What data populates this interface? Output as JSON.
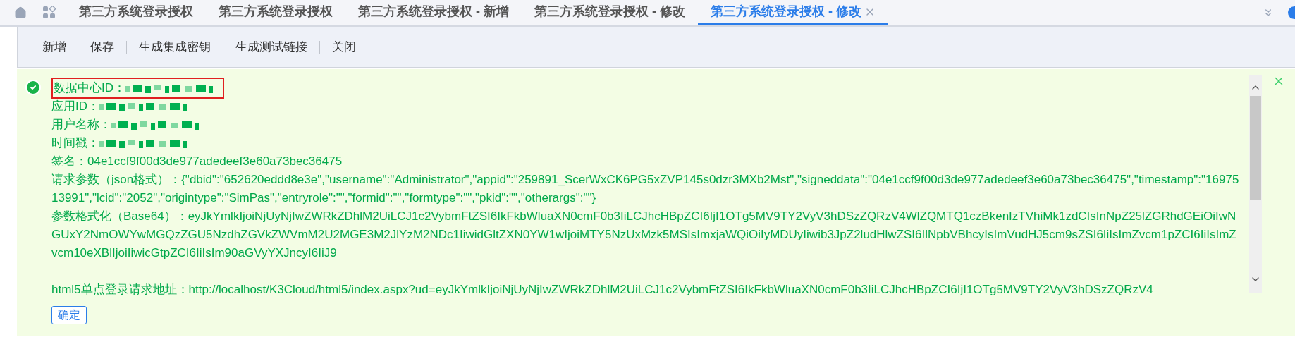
{
  "tabs": [
    {
      "label": "第三方系统登录授权",
      "selected": false,
      "closable": false
    },
    {
      "label": "第三方系统登录授权",
      "selected": false,
      "closable": false
    },
    {
      "label": "第三方系统登录授权 - 新增",
      "selected": false,
      "closable": false
    },
    {
      "label": "第三方系统登录授权 - 修改",
      "selected": false,
      "closable": false
    },
    {
      "label": "第三方系统登录授权 - 修改",
      "selected": true,
      "closable": true
    }
  ],
  "toolbar": [
    "新增",
    "保存",
    "生成集成密钥",
    "生成测试链接",
    "关闭"
  ],
  "message": {
    "lines": [
      {
        "kind": "masked",
        "label": "数据中心ID：",
        "highlighted": true
      },
      {
        "kind": "masked",
        "label": "应用ID：",
        "highlighted": false
      },
      {
        "kind": "masked",
        "label": "用户名称：",
        "highlighted": false
      },
      {
        "kind": "masked",
        "label": "时间戳：",
        "highlighted": false
      },
      {
        "kind": "text",
        "text": "签名：04e1ccf9f00d3de977adedeef3e60a73bec36475"
      },
      {
        "kind": "text",
        "text": "请求参数（json格式）：{\"dbid\":\"652620eddd8e3e\",\"username\":\"Administrator\",\"appid\":\"259891_ScerWxCK6PG5xZVP145s0dzr3MXb2Mst\",\"signeddata\":\"04e1ccf9f00d3de977adedeef3e60a73bec36475\",\"timestamp\":\"1697513991\",\"lcid\":\"2052\",\"origintype\":\"SimPas\",\"entryrole\":\"\",\"formid\":\"\",\"formtype\":\"\",\"pkid\":\"\",\"otherargs\":\"\"}"
      },
      {
        "kind": "text",
        "text": "参数格式化（Base64）：eyJkYmlkIjoiNjUyNjIwZWRkZDhlM2UiLCJ1c2VybmFtZSI6IkFkbWluaXN0cmF0b3IiLCJhcHBpZCI6IjI1OTg5MV9TY2VyV3hDSzZQRzV4WlZQMTQ1czBkenIzTVhiMk1zdCIsInNpZ25lZGRhdGEiOiIwNGUxY2NmOWYwMGQzZGU5NzdhZGVkZWVmM2U2MGE3M2JlYzM2NDc1IiwidGltZXN0YW1wIjoiMTY5NzUxMzk5MSIsImxjaWQiOiIyMDUyIiwib3JpZ2ludHlwZSI6IlNpbVBhcyIsImVudHJ5cm9sZSI6IiIsImZvcm1pZCI6IiIsImZvcm10eXBlIjoiIiwicGtpZCI6IiIsIm90aGVyYXJncyI6IiJ9"
      },
      {
        "kind": "gap"
      },
      {
        "kind": "text",
        "text": "html5单点登录请求地址：http://localhost/K3Cloud/html5/index.aspx?ud=eyJkYmlkIjoiNjUyNjIwZWRkZDhlM2UiLCJ1c2VybmFtZSI6IkFkbWluaXN0cmF0b3IiLCJhcHBpZCI6IjI1OTg5MV9TY2VyV3hDSzZQRzV4"
      }
    ],
    "confirm": "确定"
  }
}
